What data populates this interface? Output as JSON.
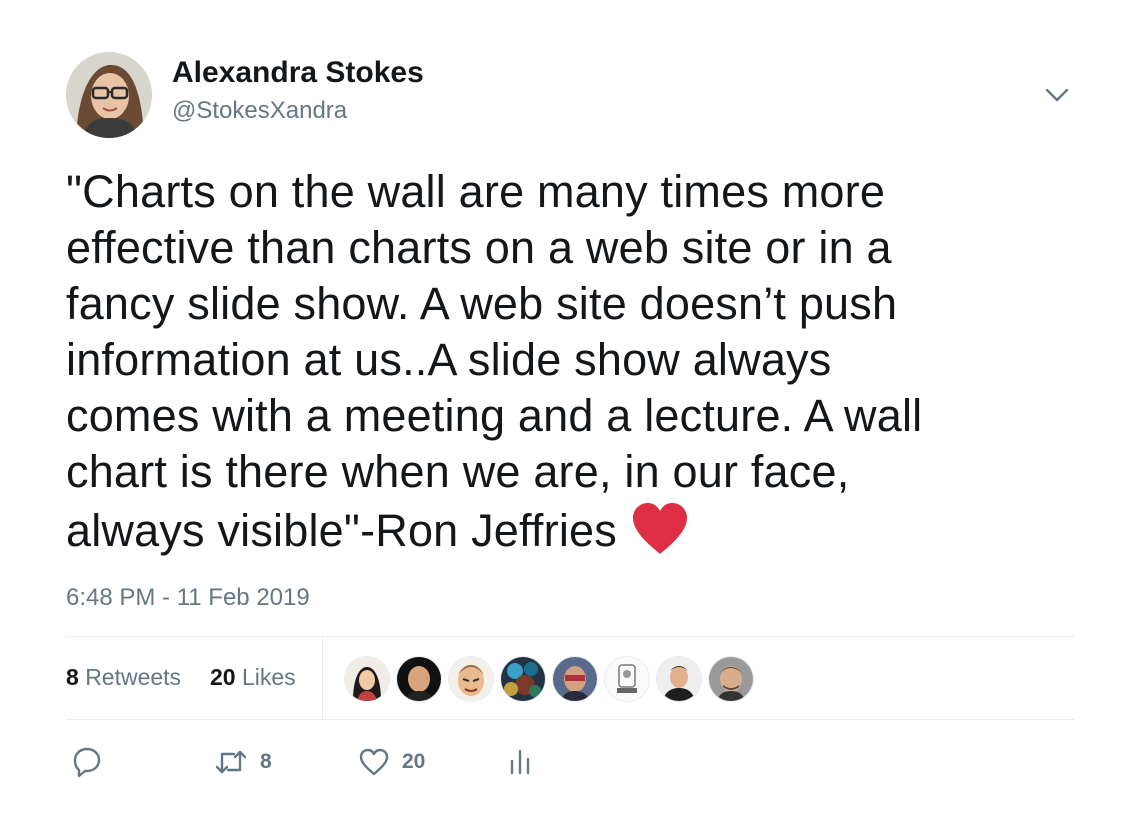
{
  "author": {
    "display_name": "Alexandra Stokes",
    "handle": "@StokesXandra"
  },
  "tweet": {
    "text_lines": [
      "\"Charts on the wall are many times more",
      "effective than charts on a web site or in a",
      "fancy slide show. A web site doesn’t push",
      "information at us..A slide show always",
      "comes with a meeting and a lecture. A wall",
      "chart is there when we are, in our face,",
      "always visible\"-Ron Jeffries"
    ],
    "emoji": "red-heart",
    "timestamp": "6:48 PM - 11 Feb 2019"
  },
  "stats": {
    "retweets_count": "8",
    "retweets_label": "Retweets",
    "likes_count": "20",
    "likes_label": "Likes"
  },
  "likers": [
    {
      "avatar": "liker-avatar-1"
    },
    {
      "avatar": "liker-avatar-2"
    },
    {
      "avatar": "liker-avatar-3"
    },
    {
      "avatar": "liker-avatar-4"
    },
    {
      "avatar": "liker-avatar-5"
    },
    {
      "avatar": "liker-avatar-6"
    },
    {
      "avatar": "liker-avatar-7"
    },
    {
      "avatar": "liker-avatar-8"
    }
  ],
  "actions": {
    "reply_icon": "reply-icon",
    "retweet_count": "8",
    "like_count": "20",
    "analytics_icon": "analytics-icon"
  },
  "colors": {
    "text": "#14171a",
    "secondary": "#657786",
    "divider": "#e6ecf0",
    "heart": "#dd2e44"
  }
}
